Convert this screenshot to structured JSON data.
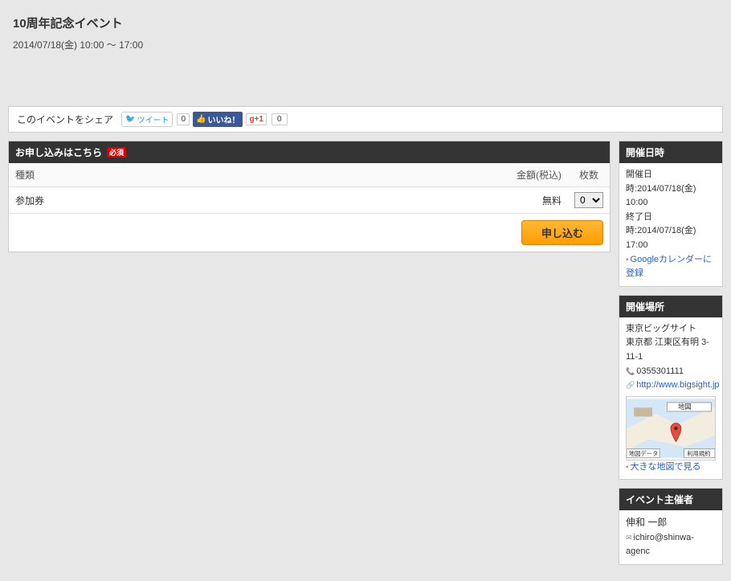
{
  "event": {
    "title": "10周年記念イベント",
    "datetime": "2014/07/18(金) 10:00 〜 17:00"
  },
  "share": {
    "label": "このイベントをシェア",
    "tweet": "ツイート",
    "tweet_count": "0",
    "fb_like": "いいね！",
    "gplus": "g+1",
    "gplus_count": "0"
  },
  "apply": {
    "heading": "お申し込みはこちら",
    "req_mark": "必須",
    "col_type": "種類",
    "col_amount": "金額(税込)",
    "col_qty": "枚数",
    "ticket_name": "参加券",
    "ticket_price": "無料",
    "qty_value": "0",
    "submit_label": "申し込む"
  },
  "schedule": {
    "heading": "開催日時",
    "start_label": "開催日時:",
    "start_value": "2014/07/18(金) 10:00",
    "end_label": "終了日時:",
    "end_value": "2014/07/18(金) 17:00",
    "gcal_link": "Googleカレンダーに登録"
  },
  "venue": {
    "heading": "開催場所",
    "name": "東京ビッグサイト",
    "address": "東京都 江東区有明 3-11-1",
    "phone": "0355301111",
    "url": "http://www.bigsight.jp",
    "map_type_label": "地図",
    "map_data_label": "地図データ",
    "map_terms_label": "利用規約",
    "big_map_link": "大きな地図で見る"
  },
  "organizer": {
    "heading": "イベント主催者",
    "name": "伸和 一郎",
    "email": "ichiro@shinwa-agenc"
  }
}
